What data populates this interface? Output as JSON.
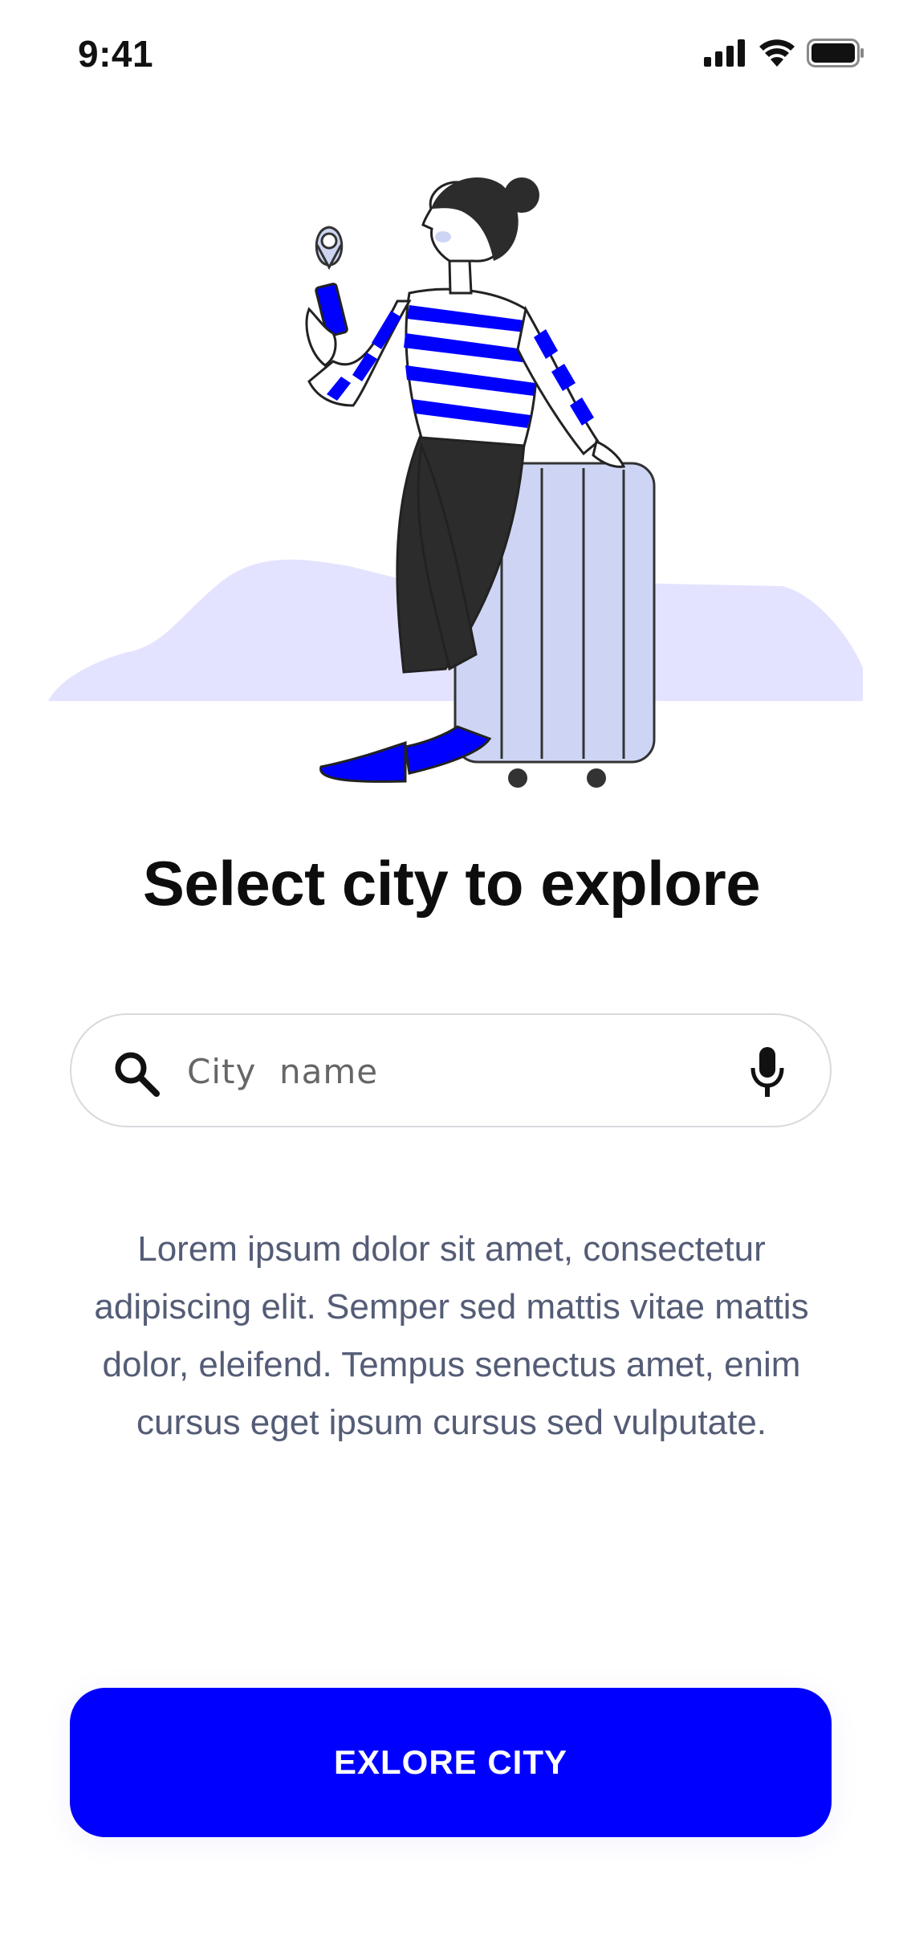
{
  "status_bar": {
    "time": "9:41"
  },
  "onboarding": {
    "title": "Select city to explore",
    "search_placeholder": "City  name",
    "description": "Lorem ipsum dolor sit amet, consectetur adipiscing elit. Semper sed mattis vitae mattis dolor, eleifend. Tempus senectus amet, enim cursus eget ipsum cursus sed vulputate.",
    "cta_label": "EXLORE CITY"
  },
  "icons": [
    "signal-icon",
    "wifi-icon",
    "battery-icon",
    "search-icon",
    "microphone-icon",
    "location-pin-icon"
  ],
  "colors": {
    "accent": "#0000FF",
    "blob": "#E4E3FF",
    "suitcase": "#CED5F4",
    "text_dark": "#0D0D0D",
    "text_muted": "#545C76"
  }
}
